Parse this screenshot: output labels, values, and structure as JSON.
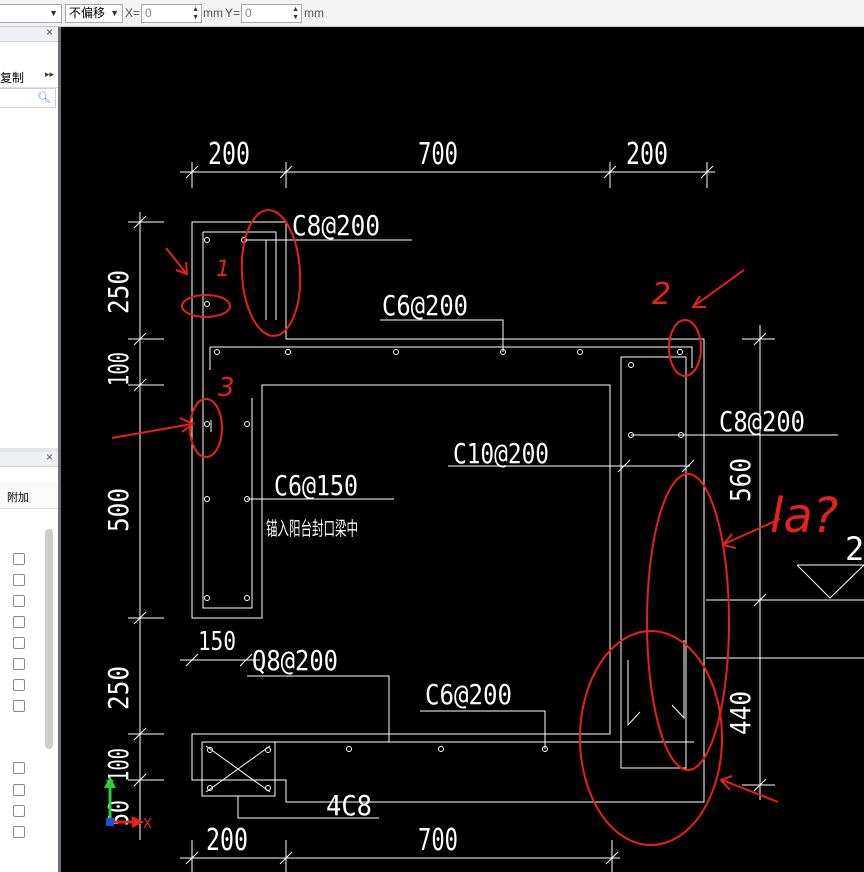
{
  "toolbar": {
    "offset_mode": "不偏移",
    "x_label": "X=",
    "x_value": "0",
    "x_unit": "mm",
    "y_label": "Y=",
    "y_value": "0",
    "y_unit": "mm"
  },
  "left_panel": {
    "tab_label": "复制",
    "column_header": "附加"
  },
  "drawing": {
    "dims_top": [
      "200",
      "700",
      "200"
    ],
    "dims_bottom": [
      "200",
      "700"
    ],
    "dims_left": [
      "250",
      "100",
      "500",
      "250",
      "100",
      "50"
    ],
    "dims_right": [
      "560",
      "440"
    ],
    "dim_150": "150",
    "right_edge_text": "2",
    "rebar_labels": {
      "c8_top": "C8@200",
      "c6_top": "C6@200",
      "c8_right": "C8@200",
      "c10": "C10@200",
      "c6_150": "C6@150",
      "note": "锚入阳台封口梁中",
      "q8": "Q8@200",
      "c6_bottom": "C6@200",
      "bottom_4c8": "4C8"
    },
    "annotations": [
      "1",
      "2",
      "3",
      "la?"
    ],
    "axis": {
      "x": "X",
      "y": "Y"
    },
    "colors": {
      "background": "#000000",
      "lines": "#ffffff",
      "markup": "#e8201b",
      "axis_x": "#e8201b",
      "axis_y": "#2ecc40",
      "origin": "#1e4fd8"
    }
  }
}
